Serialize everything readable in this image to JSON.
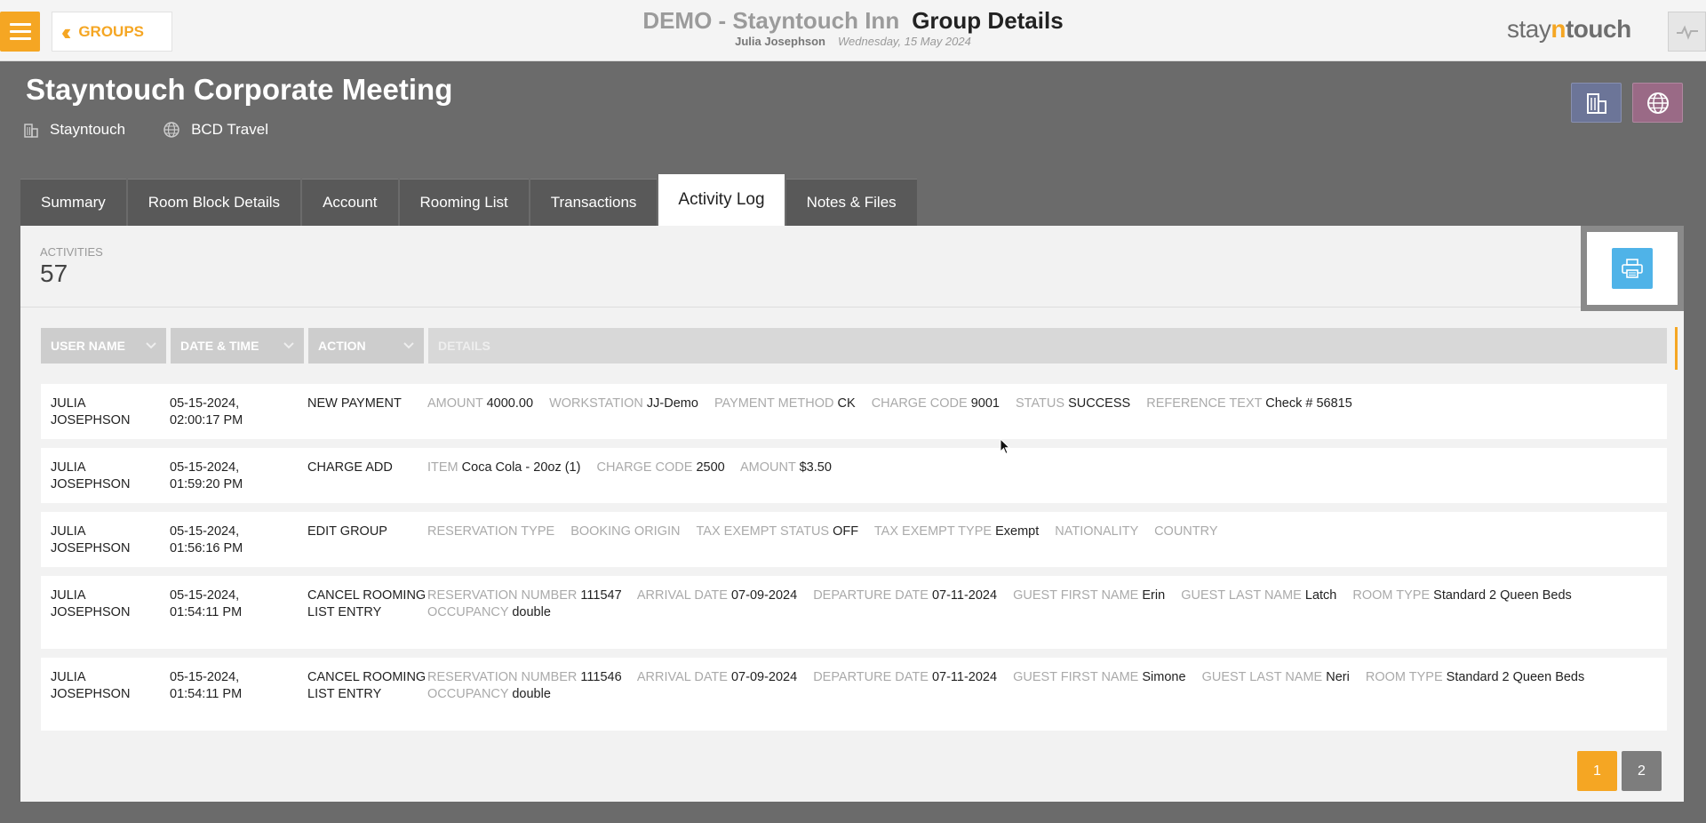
{
  "topbar": {
    "back_label": "GROUPS",
    "hotel": "DEMO - Stayntouch Inn",
    "page_title": "Group Details",
    "user": "Julia Josephson",
    "date": "Wednesday, 15 May 2024",
    "logo_a": "stay",
    "logo_b": "n",
    "logo_c": "touch"
  },
  "group": {
    "title": "Stayntouch Corporate Meeting",
    "company": "Stayntouch",
    "travel_agent": "BCD Travel"
  },
  "tabs": [
    {
      "label": "Summary"
    },
    {
      "label": "Room Block Details"
    },
    {
      "label": "Account"
    },
    {
      "label": "Rooming List"
    },
    {
      "label": "Transactions"
    },
    {
      "label": "Activity Log"
    },
    {
      "label": "Notes & Files"
    }
  ],
  "activities": {
    "label": "ACTIVITIES",
    "count": "57"
  },
  "columns": {
    "user": "USER NAME",
    "datetime": "DATE & TIME",
    "action": "ACTION",
    "details": "DETAILS"
  },
  "rows": [
    {
      "user1": "JULIA",
      "user2": "JOSEPHSON",
      "date": "05-15-2024,",
      "time": "02:00:17 PM",
      "action": "NEW PAYMENT",
      "details": [
        {
          "label": "AMOUNT",
          "value": "4000.00"
        },
        {
          "label": "WORKSTATION",
          "value": "JJ-Demo"
        },
        {
          "label": "PAYMENT METHOD",
          "value": "CK"
        },
        {
          "label": "CHARGE CODE",
          "value": "9001"
        },
        {
          "label": "STATUS",
          "value": "SUCCESS"
        },
        {
          "label": "REFERENCE TEXT",
          "value": "Check # 56815"
        }
      ]
    },
    {
      "user1": "JULIA",
      "user2": "JOSEPHSON",
      "date": "05-15-2024,",
      "time": "01:59:20 PM",
      "action": "CHARGE ADD",
      "details": [
        {
          "label": "ITEM",
          "value": "Coca Cola - 20oz (1)"
        },
        {
          "label": "CHARGE CODE",
          "value": "2500"
        },
        {
          "label": "AMOUNT",
          "value": "$3.50"
        }
      ]
    },
    {
      "user1": "JULIA",
      "user2": "JOSEPHSON",
      "date": "05-15-2024,",
      "time": "01:56:16 PM",
      "action": "EDIT GROUP",
      "details": [
        {
          "label": "RESERVATION TYPE",
          "value": ""
        },
        {
          "label": "BOOKING ORIGIN",
          "value": ""
        },
        {
          "label": "TAX EXEMPT STATUS",
          "value": "OFF"
        },
        {
          "label": "TAX EXEMPT TYPE",
          "value": "Exempt"
        },
        {
          "label": "NATIONALITY",
          "value": ""
        },
        {
          "label": "COUNTRY",
          "value": ""
        }
      ]
    },
    {
      "user1": "JULIA",
      "user2": "JOSEPHSON",
      "date": "05-15-2024,",
      "time": "01:54:11 PM",
      "action": "CANCEL ROOMING LIST ENTRY",
      "details": [
        {
          "label": "RESERVATION NUMBER",
          "value": "111547"
        },
        {
          "label": "ARRIVAL DATE",
          "value": "07-09-2024"
        },
        {
          "label": "DEPARTURE DATE",
          "value": "07-11-2024"
        },
        {
          "label": "GUEST FIRST NAME",
          "value": "Erin"
        },
        {
          "label": "GUEST LAST NAME",
          "value": "Latch"
        },
        {
          "label": "ROOM TYPE",
          "value": "Standard 2 Queen Beds"
        },
        {
          "label": "OCCUPANCY",
          "value": "double"
        }
      ]
    },
    {
      "user1": "JULIA",
      "user2": "JOSEPHSON",
      "date": "05-15-2024,",
      "time": "01:54:11 PM",
      "action": "CANCEL ROOMING LIST ENTRY",
      "details": [
        {
          "label": "RESERVATION NUMBER",
          "value": "111546"
        },
        {
          "label": "ARRIVAL DATE",
          "value": "07-09-2024"
        },
        {
          "label": "DEPARTURE DATE",
          "value": "07-11-2024"
        },
        {
          "label": "GUEST FIRST NAME",
          "value": "Simone"
        },
        {
          "label": "GUEST LAST NAME",
          "value": "Neri"
        },
        {
          "label": "ROOM TYPE",
          "value": "Standard 2 Queen Beds"
        },
        {
          "label": "OCCUPANCY",
          "value": "double"
        }
      ]
    }
  ],
  "pagination": {
    "pages": [
      "1",
      "2"
    ],
    "current": "1"
  },
  "colors": {
    "accent": "#f5a623",
    "print": "#4fb3e8"
  }
}
